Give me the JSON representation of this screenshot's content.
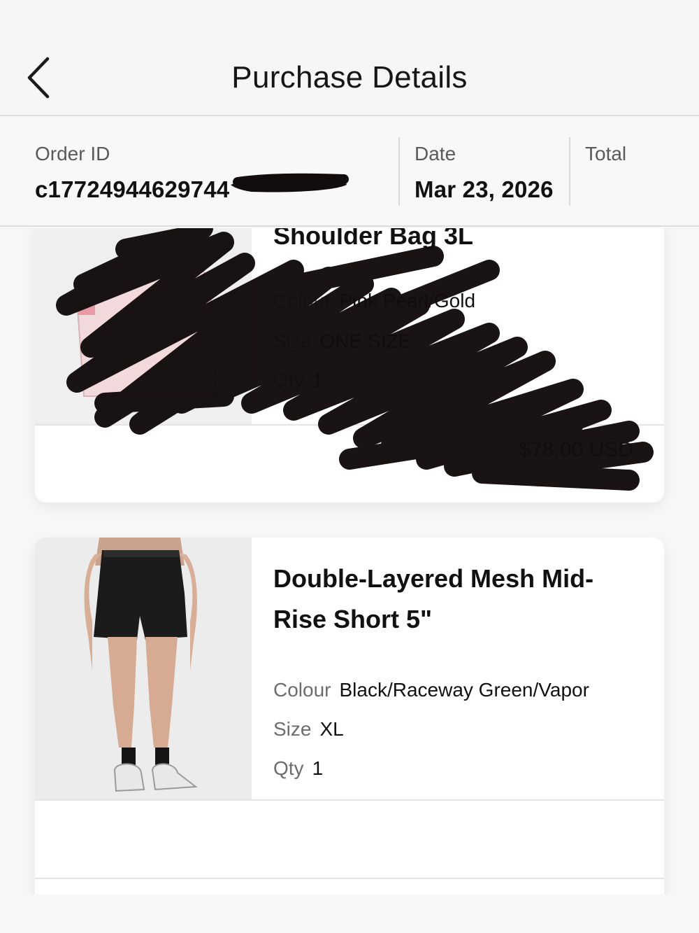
{
  "header": {
    "title": "Purchase Details",
    "back_icon": "chevron-left-icon"
  },
  "summary": {
    "order_id_label": "Order ID",
    "order_id_value": "c17724944629744",
    "date_label": "Date",
    "date_value": "Mar 23, 2026",
    "total_label": "Total",
    "total_value": ""
  },
  "items": [
    {
      "name": "Shoulder Bag 3L",
      "colour_label": "Colour",
      "colour_value": "Pink Pearl/Gold",
      "size_label": "Size",
      "size_value": "ONE SIZE",
      "qty_label": "Qty",
      "qty_value": "1",
      "price": "$78.00 USD",
      "redacted": true
    },
    {
      "name": "Double-Layered Mesh Mid-Rise Short 5\"",
      "colour_label": "Colour",
      "colour_value": "Black/Raceway Green/Vapor",
      "size_label": "Size",
      "size_value": "XL",
      "qty_label": "Qty",
      "qty_value": "1",
      "price": ""
    }
  ],
  "colors": {
    "background": "#f7f7f7",
    "card": "#ffffff",
    "redaction": "#120c0c"
  }
}
